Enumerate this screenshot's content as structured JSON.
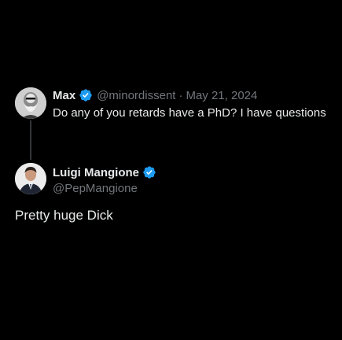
{
  "colors": {
    "background": "#000000",
    "text_primary": "#e7e9ea",
    "text_secondary": "#71767b",
    "verified_badge": "#1d9bf0",
    "thread_line": "#333639"
  },
  "quoted_tweet": {
    "author_name": "Max",
    "verified": true,
    "handle": "@minordissent",
    "separator": "·",
    "date": "May 21, 2024",
    "text": "Do any of you retards have a PhD? I have questions",
    "avatar_icon": "bearded-man-avatar"
  },
  "main_tweet": {
    "author_name": "Luigi Mangione",
    "verified": true,
    "handle": "@PepMangione",
    "text": "Pretty huge Dick",
    "avatar_icon": "man-in-suit-avatar"
  }
}
